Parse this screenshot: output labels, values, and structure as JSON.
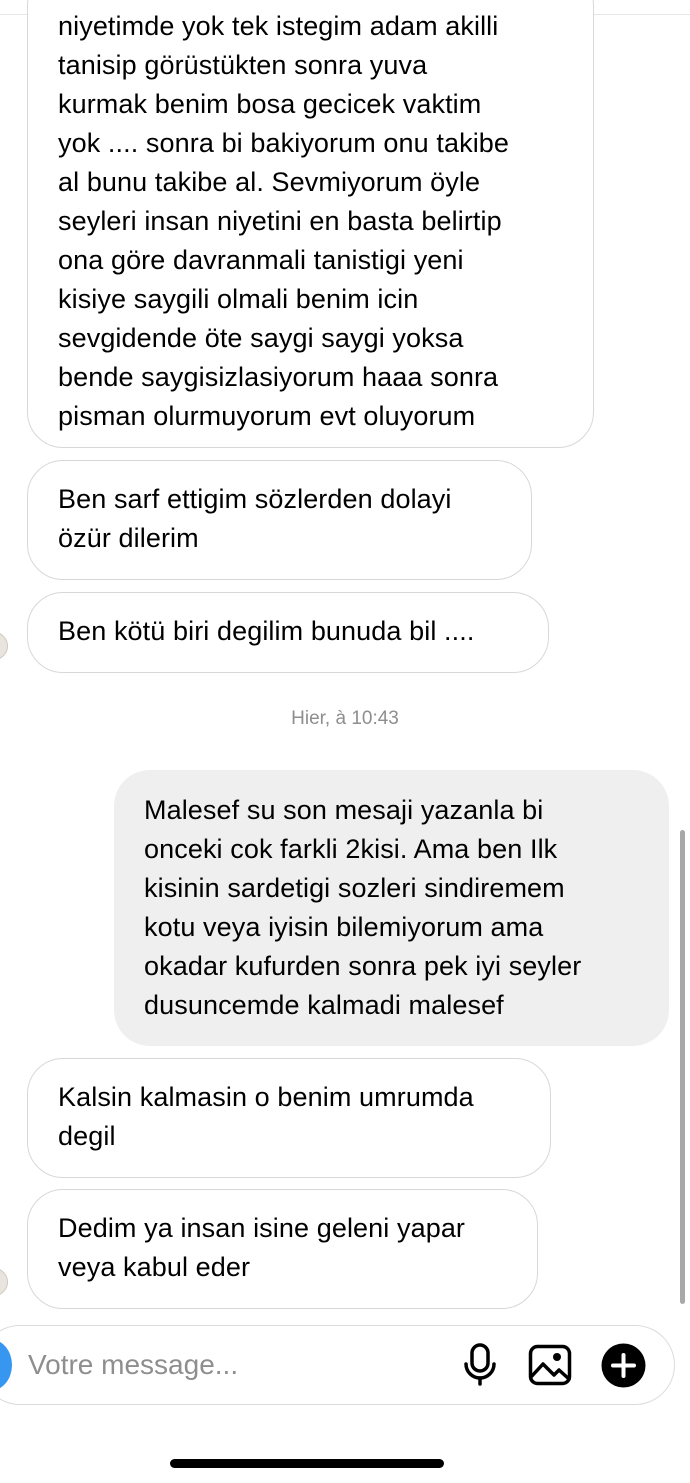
{
  "messages": [
    {
      "lines": [
        "niyetimde yok tek istegim adam akilli",
        "tanisip görüstükten sonra yuva",
        "kurmak benim bosa gecicek vaktim",
        "yok .... sonra bi bakiyorum onu takibe",
        "al bunu takibe al. Sevmiyorum öyle",
        "seyleri insan niyetini en basta belirtip",
        "ona göre davranmali tanistigi yeni",
        "kisiye saygili olmali benim icin",
        "sevgidende öte saygi saygi yoksa",
        "bende saygisizlasiyorum haaa sonra",
        "pisman olurmuyorum evt oluyorum"
      ]
    },
    {
      "lines": [
        "Ben sarf ettigim sözlerden dolayi",
        "özür dilerim"
      ]
    },
    {
      "lines": [
        "Ben kötü biri degilim bunuda bil ...."
      ]
    },
    {
      "lines": [
        "Malesef su son mesaji yazanla bi",
        "onceki cok farkli 2kisi. Ama ben Ilk",
        "kisinin sardetigi sozleri sindiremem",
        "kotu veya iyisin bilemiyorum ama",
        "okadar kufurden sonra pek iyi seyler",
        "dusuncemde kalmadi malesef"
      ]
    },
    {
      "lines": [
        "Kalsin kalmasin o benim umrumda",
        "degil"
      ]
    },
    {
      "lines": [
        "Dedim ya insan isine geleni yapar",
        "veya kabul eder"
      ]
    }
  ],
  "timestamp": "Hier, à 10:43",
  "composer": {
    "placeholder": "Votre message...",
    "icons": [
      "microphone-icon",
      "gallery-icon",
      "add-plus-icon"
    ]
  },
  "colors": {
    "outgoing_bubble": "#efefef",
    "incoming_border": "#d8d8d8",
    "timestamp": "#8e8e8e",
    "camera_button": "#3797f0"
  }
}
